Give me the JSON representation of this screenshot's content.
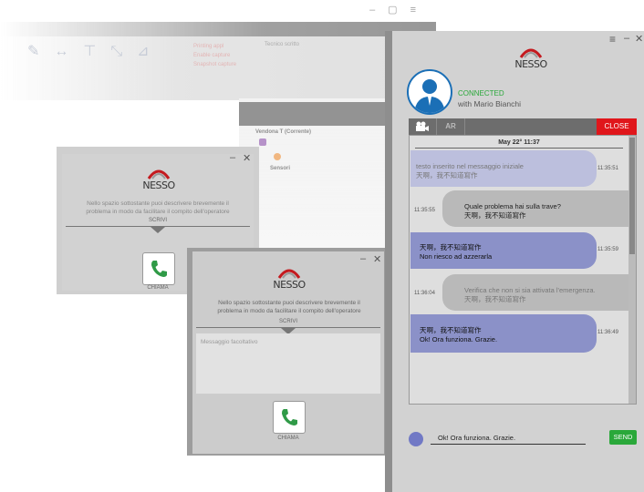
{
  "background_app": {
    "ribbon_items": [
      "Printing appl",
      "Enable capture",
      "Snapshot capture"
    ],
    "ribbon_item2": "Tecnico scritto",
    "tree_items": [
      "Vendona T (Corrente)",
      "Sensori"
    ]
  },
  "popup1": {
    "logo_text": "NESSO",
    "description": "Nello spazio sottostante puoi descrivere brevemente il problema in modo da facilitare il compito dell'operatore",
    "write_label": "SCRIVI",
    "call_label": "CHIAMA"
  },
  "popup2": {
    "logo_text": "NESSO",
    "description": "Nello spazio sottostante puoi descrivere brevemente il problema in modo da facilitare il compito dell'operatore",
    "write_label": "SCRIVI",
    "message_placeholder": "Messaggio facoltativo",
    "call_label": "CHIAMA"
  },
  "chat": {
    "logo_text": "NESSO",
    "status": "CONNECTED",
    "with_text": "with Mario Bianchi",
    "toolbar": {
      "video_icon": "video-camera-icon",
      "ar_label": "AR",
      "close_label": "CLOSE"
    },
    "date_header": "May 22° 11:37",
    "messages": [
      {
        "side": "left",
        "line1": "testo inserito nel messaggio iniziale",
        "line2": "天啊，我不知道寫作",
        "time": "11:35:51"
      },
      {
        "side": "right",
        "line1": "Quale problema hai sulla trave?",
        "line2": "天啊，我不知道寫作",
        "time": "11:35:55"
      },
      {
        "side": "left",
        "line1": "天啊，我不知道寫作",
        "line2": "Non riesco ad azzerarla",
        "time": "11:35:59"
      },
      {
        "side": "right",
        "line1": "Verifica che non si sia attivata l'emergenza.",
        "line2": "天啊，我不知道寫作",
        "time": "11:36:04"
      },
      {
        "side": "left",
        "line1": "天啊，我不知道寫作",
        "line2": "Ok! Ora funziona. Grazie.",
        "time": "11:36:49"
      }
    ],
    "compose_value": "Ok! Ora funziona. Grazie.",
    "send_label": "SEND",
    "colors": {
      "accent_green": "#2aa83a",
      "close_red": "#e0161b",
      "bubble_blue": "#8b91c8",
      "bubble_gray": "#b9b9b9",
      "avatar_blue": "#1b6fb6"
    }
  }
}
